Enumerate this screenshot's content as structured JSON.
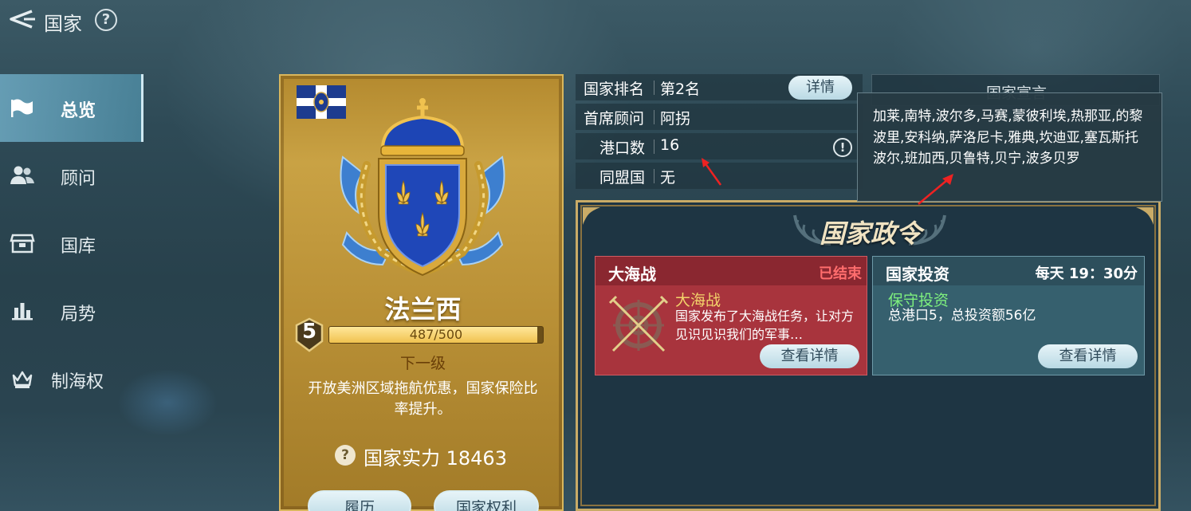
{
  "header": {
    "title": "国家"
  },
  "sidebar": {
    "items": [
      {
        "label": "总览",
        "icon": "flag-icon",
        "active": true
      },
      {
        "label": "顾问",
        "icon": "people-icon",
        "active": false
      },
      {
        "label": "国库",
        "icon": "treasury-icon",
        "active": false
      },
      {
        "label": "局势",
        "icon": "bar-chart-icon",
        "active": false
      },
      {
        "label": "制海权",
        "icon": "crown-icon",
        "active": false
      }
    ]
  },
  "nation": {
    "name": "法兰西",
    "level": "5",
    "exp_text": "487/500",
    "exp_fraction": 0.974,
    "next_level_label": "下一级",
    "next_level_desc": "开放美洲区域拖航优惠，国家保险比率提升。",
    "power_text": "国家实力 18463",
    "buttons": {
      "history": "履历",
      "rights": "国家权利"
    }
  },
  "info": {
    "rank_label": "国家排名",
    "rank_value": "第2名",
    "advisor_label": "首席顾问",
    "advisor_value": "阿拐",
    "ports_label": "港口数",
    "ports_value": "16",
    "ally_label": "同盟国",
    "ally_value": "无",
    "detail_button": "详情",
    "manifesto_label": "国家宣言"
  },
  "tooltip": {
    "text": "加莱,南特,波尔多,马赛,蒙彼利埃,热那亚,的黎波里,安科纳,萨洛尼卡,雅典,坎迪亚,塞瓦斯托波尔,班加西,贝鲁特,贝宁,波多贝罗"
  },
  "decrees": {
    "title": "国家政令",
    "cards": [
      {
        "name": "大海战",
        "status": "已结束",
        "subtitle": "大海战",
        "desc": "国家发布了大海战任务，让对方见识见识我们的军事…",
        "button": "查看详情"
      },
      {
        "name": "国家投资",
        "time": "每天 19：30分",
        "subtitle": "保守投资",
        "desc": "总港口5，总投资额56亿",
        "button": "查看详情"
      }
    ]
  },
  "colors": {
    "accent_gold": "#c9a244",
    "status_red": "#ff6d6d",
    "invest_green": "#7ef07e",
    "war_gold": "#f3d36a"
  }
}
